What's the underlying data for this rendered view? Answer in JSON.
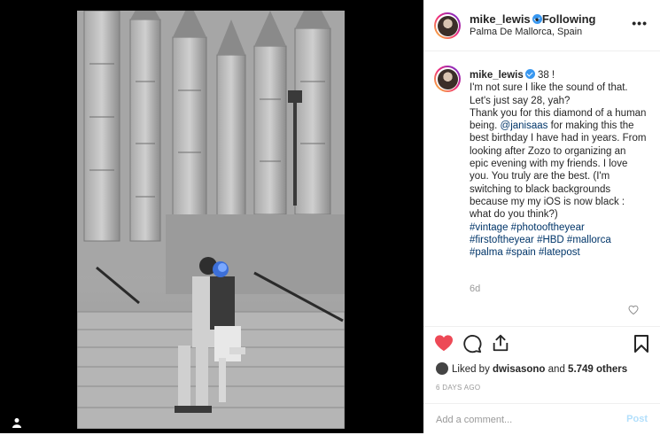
{
  "post": {
    "username": "mike_lewis",
    "follow_dot": "•",
    "follow_label": "Following",
    "location": "Palma De Mallorca, Spain",
    "more_label": "•••"
  },
  "caption": {
    "username": "mike_lewis",
    "line_1": "38 !",
    "line_2": "I'm not sure I like the sound of that. Let's just say 28, yah?",
    "line_3_pre": "Thank you for this diamond of a human being. ",
    "mention": "@janisaas",
    "line_3_post": " for making this the best birthday I have had in years. From looking after Zozo to organizing an epic evening with my friends. I love you. You truly are the best. (I'm switching to black backgrounds because my my iOS is now black : what do you think?)",
    "hashtags": "#vintage #photooftheyear #firstoftheyear #HBD #mallorca #palma #spain #latepost",
    "age": "6d"
  },
  "likes": {
    "prefix": "Liked by ",
    "user": "dwisasono",
    "middle": " and ",
    "count": "5.749 others"
  },
  "timestamp": "6 DAYS AGO",
  "comment": {
    "placeholder": "Add a comment...",
    "post_label": "Post"
  },
  "colors": {
    "like_red": "#ed4956",
    "link_blue": "#003569",
    "verified_blue": "#3897f0",
    "post_disabled": "#b2dffc"
  },
  "icons": [
    "heart-icon",
    "comment-icon",
    "share-icon",
    "bookmark-icon",
    "more-icon",
    "verified-icon",
    "small-heart-icon",
    "user-icon"
  ]
}
